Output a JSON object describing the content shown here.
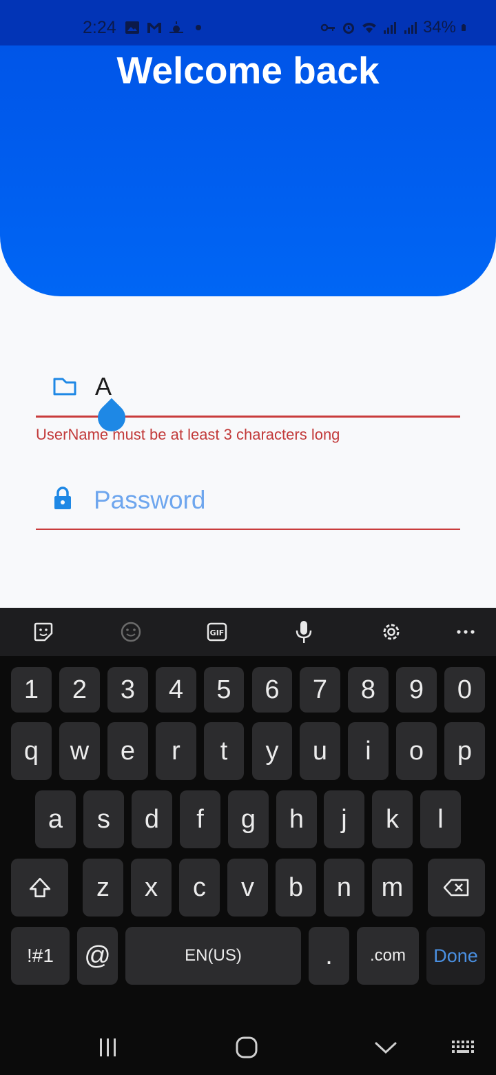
{
  "status": {
    "time": "2:24",
    "battery": "34%",
    "left_icons": [
      "gallery-icon",
      "gmail-icon",
      "weather-icon",
      "dot-icon"
    ],
    "right_icons": [
      "vpn-key-icon",
      "alarm-icon",
      "wifi-icon",
      "signal-icon",
      "signal-icon",
      "battery-icon"
    ]
  },
  "header": {
    "title": "Welcome back",
    "gradient_top": "#0055e8",
    "gradient_bottom": "#0066f5"
  },
  "form": {
    "username": {
      "value": "A",
      "icon": "folder-icon",
      "error": "UserName must be at least 3 characters long"
    },
    "password": {
      "placeholder": "Password",
      "icon": "lock-icon"
    },
    "error_color": "#c93c3c",
    "accent": "#1e88e5"
  },
  "keyboard": {
    "toolbar": [
      "sticker-icon",
      "emoji-icon",
      "gif-icon",
      "mic-icon",
      "settings-icon",
      "more-icon"
    ],
    "rows": [
      [
        "1",
        "2",
        "3",
        "4",
        "5",
        "6",
        "7",
        "8",
        "9",
        "0"
      ],
      [
        "q",
        "w",
        "e",
        "r",
        "t",
        "y",
        "u",
        "i",
        "o",
        "p"
      ],
      [
        "a",
        "s",
        "d",
        "f",
        "g",
        "h",
        "j",
        "k",
        "l"
      ],
      [
        "z",
        "x",
        "c",
        "v",
        "b",
        "n",
        "m"
      ]
    ],
    "bottom": {
      "symbols": "!#1",
      "at": "@",
      "space": "EN(US)",
      "period": ".",
      "dotcom": ".com",
      "done": "Done"
    }
  },
  "nav": [
    "recent-apps-icon",
    "home-icon",
    "back-icon",
    "keyboard-icon"
  ]
}
